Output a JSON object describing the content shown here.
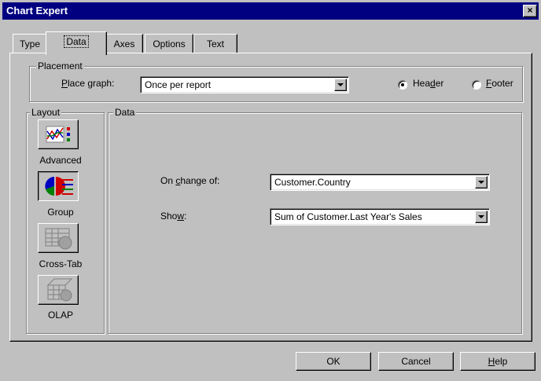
{
  "window": {
    "title": "Chart Expert",
    "close_glyph": "×"
  },
  "tabs": [
    {
      "label": "Type",
      "active": false
    },
    {
      "label": "Data",
      "active": true
    },
    {
      "label": "Axes",
      "active": false
    },
    {
      "label": "Options",
      "active": false
    },
    {
      "label": "Text",
      "active": false
    }
  ],
  "placement": {
    "legend": "Placement",
    "place_graph_label_mnemonic": "P",
    "place_graph_label_rest": "lace graph:",
    "place_graph_value": "Once per report",
    "header": {
      "label_pre": "Hea",
      "label_mnemonic": "d",
      "label_post": "er",
      "checked": true
    },
    "footer": {
      "label_pre": "",
      "label_mnemonic": "F",
      "label_post": "ooter",
      "checked": false
    }
  },
  "layout": {
    "legend": "Layout",
    "items": [
      {
        "label": "Advanced",
        "icon": "advanced-chart-icon",
        "pressed": false
      },
      {
        "label": "Group",
        "icon": "group-chart-icon",
        "pressed": true
      },
      {
        "label": "Cross-Tab",
        "icon": "cross-tab-icon",
        "pressed": false,
        "disabled": true
      },
      {
        "label": "OLAP",
        "icon": "olap-icon",
        "pressed": false,
        "disabled": true
      }
    ]
  },
  "data": {
    "legend": "Data",
    "on_change_pre": "On ",
    "on_change_mnemonic": "c",
    "on_change_post": "hange of:",
    "on_change_value": "Customer.Country",
    "show_pre": "Sho",
    "show_mnemonic": "w",
    "show_post": ":",
    "show_value": "Sum of Customer.Last Year's Sales"
  },
  "buttons": {
    "ok": "OK",
    "cancel": "Cancel",
    "help_mnemonic": "H",
    "help_rest": "elp"
  }
}
